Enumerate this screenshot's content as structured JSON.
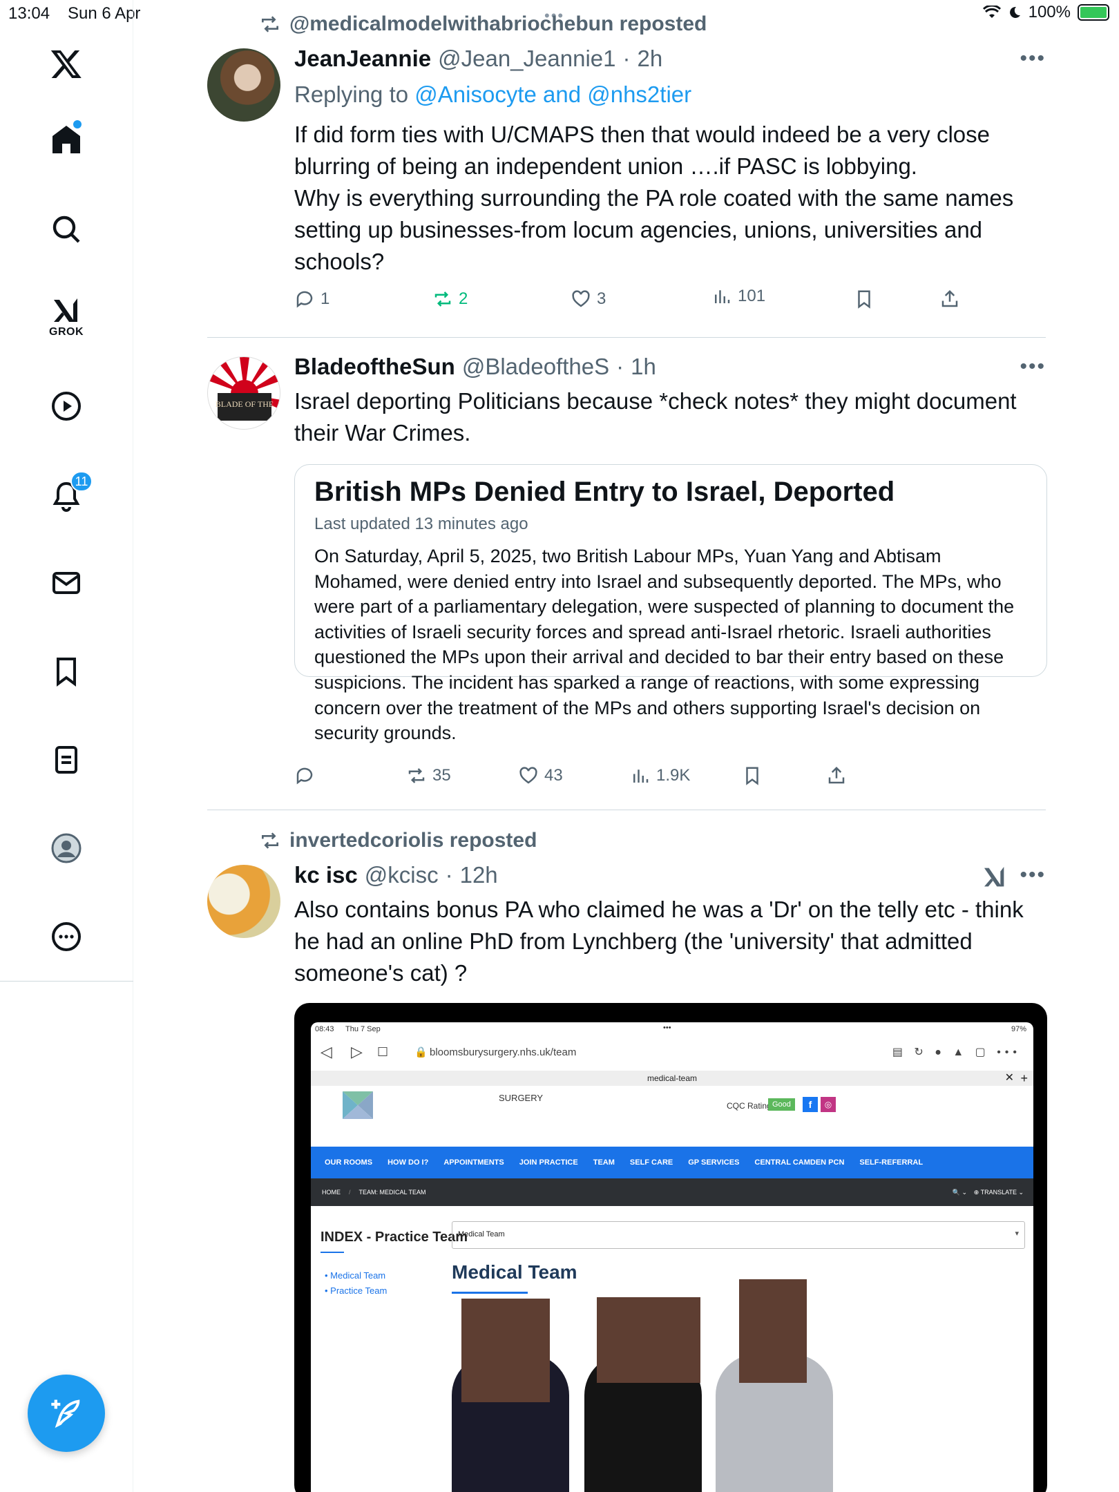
{
  "status_bar": {
    "time": "13:04",
    "date": "Sun 6 Apr",
    "battery": "100%",
    "battery_level": 1.0
  },
  "sidebar": {
    "items": [
      {
        "name": "home",
        "icon": "home-icon"
      },
      {
        "name": "search",
        "icon": "search-icon"
      },
      {
        "name": "grok",
        "icon": "grok-icon",
        "label": "GROK"
      },
      {
        "name": "video",
        "icon": "play-icon"
      },
      {
        "name": "notifications",
        "icon": "bell-icon",
        "badge": "11"
      },
      {
        "name": "messages",
        "icon": "mail-icon"
      },
      {
        "name": "bookmarks",
        "icon": "bookmark-icon"
      },
      {
        "name": "lists",
        "icon": "list-icon"
      },
      {
        "name": "profile",
        "icon": "profile-icon"
      },
      {
        "name": "more",
        "icon": "more-circle-icon"
      }
    ],
    "compose_icon": "compose-icon",
    "accent": "#1d9bf0"
  },
  "tweets": [
    {
      "repost_by": "@medicalmodelwithabriochebun reposted",
      "display_name": "JeanJeannie",
      "handle": "@Jean_Jeannie1",
      "time": "2h",
      "reply_prefix": "Replying to ",
      "reply_to": "@Anisocyte and @nhs2tier",
      "text": "If did form ties with U/CMAPS then that would indeed be a very close blurring of being an independent union ….if PASC is lobbying.\nWhy is everything surrounding the PA role coated with the same names setting up businesses-from locum agencies, unions, universities and schools?",
      "replies": "1",
      "reposts": "2",
      "likes": "3",
      "views": "101"
    },
    {
      "display_name": "BladeoftheSun",
      "handle": "@BladeoftheS",
      "time": "1h",
      "avatar_text": "BLADE OF THE",
      "text": "Israel deporting Politicians because *check notes* they might document their War Crimes.",
      "card": {
        "title": "British MPs Denied Entry to Israel, Deported",
        "meta": "Last updated 13 minutes ago",
        "body": "On Saturday, April 5, 2025, two British Labour MPs, Yuan Yang and Abtisam Mohamed, were denied entry into Israel and subsequently deported. The MPs, who were part of a parliamentary delegation, were suspected of planning to document the activities of Israeli security forces and spread anti-Israel rhetoric. Israeli authorities questioned the MPs upon their arrival and decided to bar their entry based on these suspicions. The incident has sparked a range of reactions, with some expressing concern over the treatment of the MPs and others supporting Israel's decision on security grounds."
      },
      "replies": "",
      "reposts": "35",
      "likes": "43",
      "views": "1.9K"
    },
    {
      "repost_by": "invertedcoriolis reposted",
      "display_name": "kc isc",
      "handle": "@kcisc",
      "time": "12h",
      "text": "Also contains bonus PA who claimed he was a 'Dr' on the telly etc - think he had an online PhD from Lynchberg (the 'university' that admitted someone's cat) ?",
      "media": {
        "status_time": "08:43",
        "status_date": "Thu 7 Sep",
        "status_battery": "97%",
        "url": "bloomsburysurgery.nhs.uk/team",
        "tab_title": "medical-team",
        "site_name": "SURGERY",
        "cqc_label": "CQC Rating",
        "cqc_value": "Good",
        "menu": [
          "OUR ROOMS",
          "HOW DO I?",
          "APPOINTMENTS",
          "JOIN PRACTICE",
          "TEAM",
          "SELF CARE",
          "GP SERVICES",
          "CENTRAL CAMDEN PCN",
          "SELF-REFERRAL"
        ],
        "crumb_home": "HOME",
        "crumb_current": "TEAM: MEDICAL TEAM",
        "translate": "TRANSLATE",
        "index_title": "INDEX - Practice Team",
        "index_links": [
          "Medical Team",
          "Practice Team"
        ],
        "select_value": "Medical Team",
        "section_title": "Medical Team"
      }
    }
  ]
}
